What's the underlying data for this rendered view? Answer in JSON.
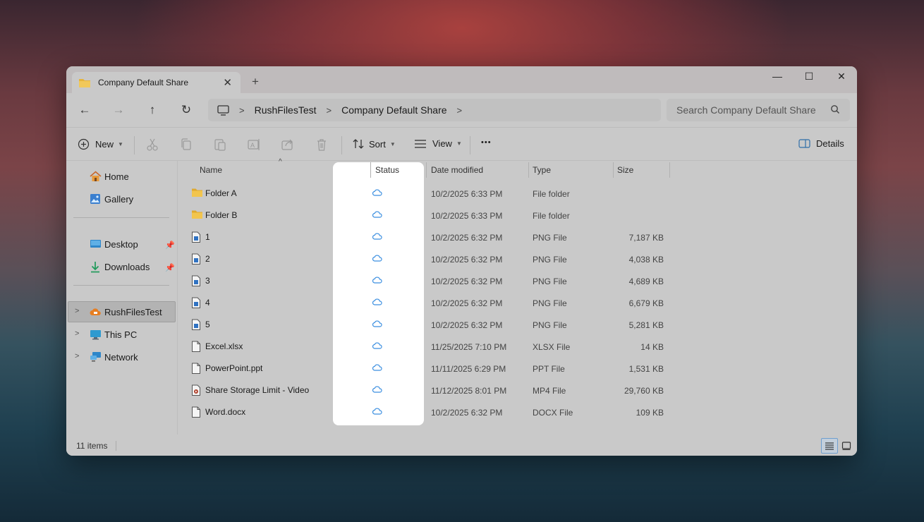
{
  "tab": {
    "title": "Company Default Share",
    "close": "✕",
    "new": "+"
  },
  "window_controls": {
    "minimize": "—",
    "maximize": "☐",
    "close": "✕"
  },
  "nav": {
    "back": "←",
    "forward": "→",
    "up": "↑",
    "refresh": "↻"
  },
  "address": {
    "crumbs": [
      "RushFilesTest",
      "Company Default Share"
    ],
    "separator": ">"
  },
  "search": {
    "placeholder": "Search Company Default Share"
  },
  "commands": {
    "new": "New",
    "sort": "Sort",
    "view": "View",
    "more": "•••",
    "details": "Details"
  },
  "sidebar": {
    "quick": [
      {
        "label": "Home",
        "icon": "home-icon"
      },
      {
        "label": "Gallery",
        "icon": "gallery-icon"
      }
    ],
    "pinned": [
      {
        "label": "Desktop",
        "icon": "desktop-icon"
      },
      {
        "label": "Downloads",
        "icon": "downloads-icon"
      }
    ],
    "locations": [
      {
        "label": "RushFilesTest",
        "icon": "cloud-drive-icon",
        "selected": true
      },
      {
        "label": "This PC",
        "icon": "monitor-icon"
      },
      {
        "label": "Network",
        "icon": "network-icon"
      }
    ]
  },
  "columns": {
    "name": "Name",
    "status": "Status",
    "date": "Date modified",
    "type": "Type",
    "size": "Size"
  },
  "files": [
    {
      "name": "Folder A",
      "kind": "folder",
      "date": "10/2/2025 6:33 PM",
      "type": "File folder",
      "size": ""
    },
    {
      "name": "Folder B",
      "kind": "folder",
      "date": "10/2/2025 6:33 PM",
      "type": "File folder",
      "size": ""
    },
    {
      "name": "1",
      "kind": "image",
      "date": "10/2/2025 6:32 PM",
      "type": "PNG File",
      "size": "7,187 KB"
    },
    {
      "name": "2",
      "kind": "image",
      "date": "10/2/2025 6:32 PM",
      "type": "PNG File",
      "size": "4,038 KB"
    },
    {
      "name": "3",
      "kind": "image",
      "date": "10/2/2025 6:32 PM",
      "type": "PNG File",
      "size": "4,689 KB"
    },
    {
      "name": "4",
      "kind": "image",
      "date": "10/2/2025 6:32 PM",
      "type": "PNG File",
      "size": "6,679 KB"
    },
    {
      "name": "5",
      "kind": "image",
      "date": "10/2/2025 6:32 PM",
      "type": "PNG File",
      "size": "5,281 KB"
    },
    {
      "name": "Excel.xlsx",
      "kind": "doc",
      "date": "11/25/2025 7:10 PM",
      "type": "XLSX File",
      "size": "14 KB"
    },
    {
      "name": "PowerPoint.ppt",
      "kind": "doc",
      "date": "11/11/2025 6:29 PM",
      "type": "PPT File",
      "size": "1,531 KB"
    },
    {
      "name": "Share Storage Limit - Video",
      "kind": "video",
      "date": "11/12/2025 8:01 PM",
      "type": "MP4 File",
      "size": "29,760 KB"
    },
    {
      "name": "Word.docx",
      "kind": "doc",
      "date": "10/2/2025 6:32 PM",
      "type": "DOCX File",
      "size": "109 KB"
    }
  ],
  "statusbar": {
    "count": "11 items"
  },
  "colors": {
    "accent": "#3a8ee0",
    "folder": "#e6b43a",
    "cloud_orange": "#e67e22"
  }
}
